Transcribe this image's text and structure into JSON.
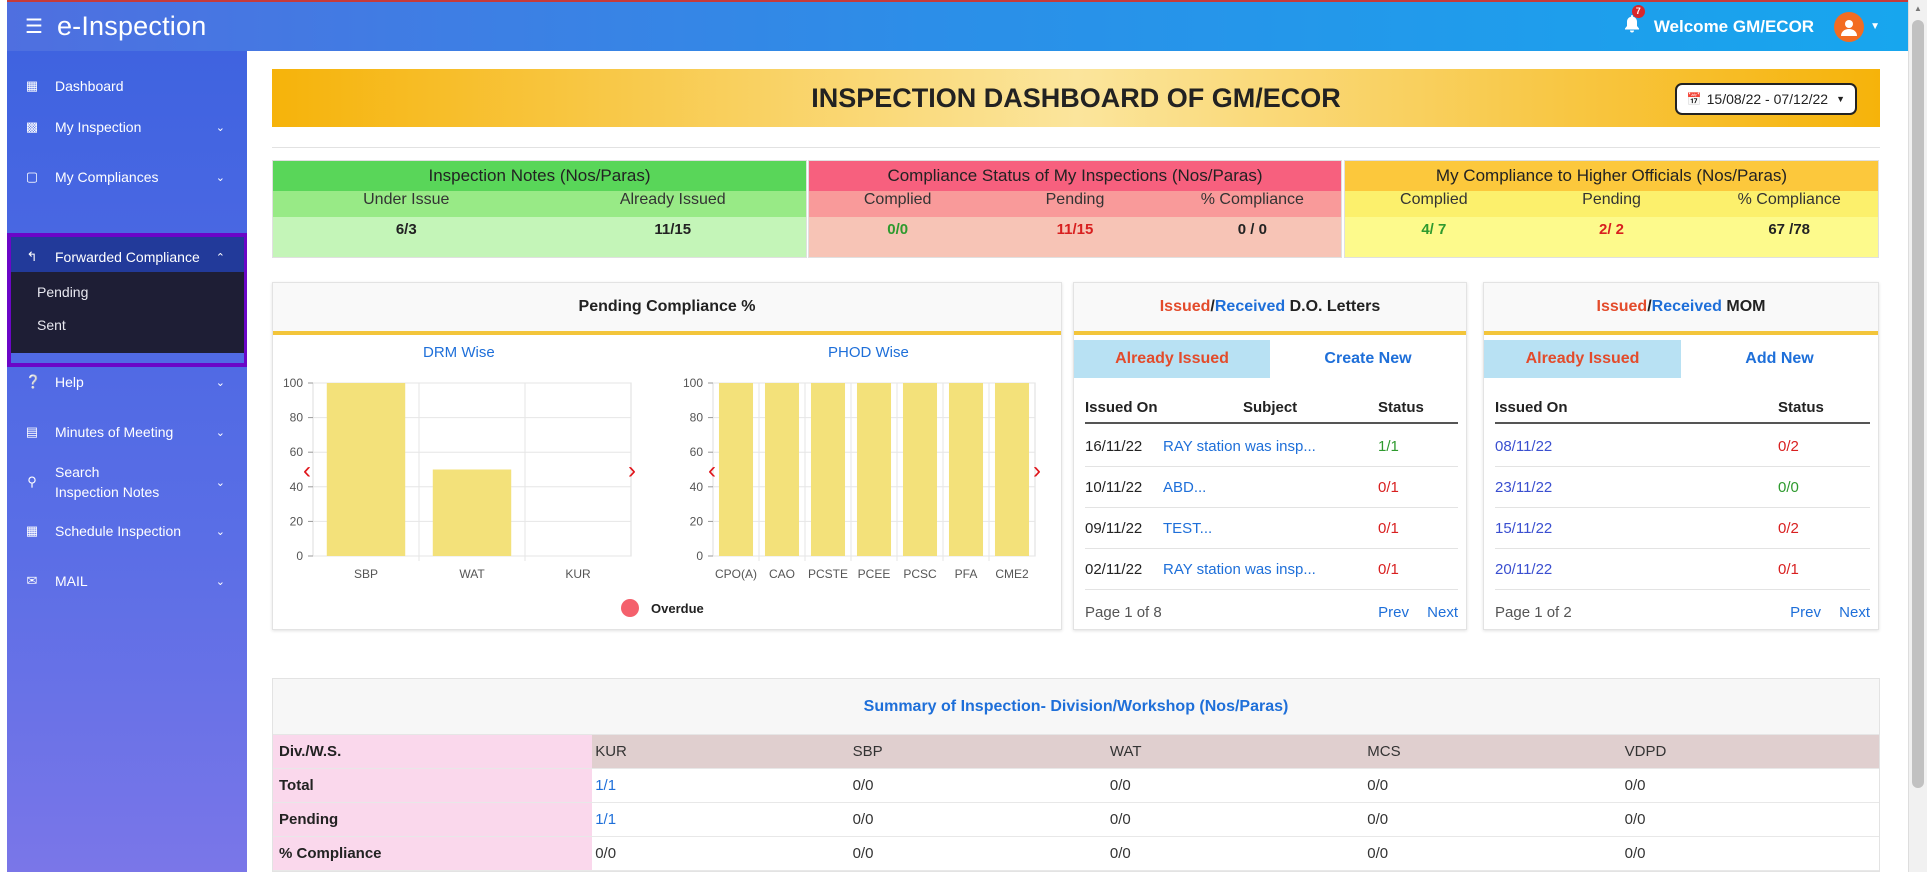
{
  "app": {
    "title": "e-Inspection",
    "notification_count": "7",
    "welcome": "Welcome  GM/ECOR"
  },
  "sidebar": {
    "items": [
      {
        "label": "Dashboard",
        "icon": "dashboard-icon"
      },
      {
        "label": "My Inspection",
        "icon": "clipboard-icon"
      },
      {
        "label": "My Compliances",
        "icon": "document-icon"
      },
      {
        "label": "Forwarded Compliance",
        "icon": "reply-icon"
      },
      {
        "label": "Help",
        "icon": "question-icon"
      },
      {
        "label": "Minutes of Meeting",
        "icon": "note-icon"
      },
      {
        "label": "Search Inspection Notes",
        "icon": "search-icon"
      },
      {
        "label": "Schedule Inspection",
        "icon": "calendar-icon"
      },
      {
        "label": "MAIL",
        "icon": "mail-icon"
      }
    ],
    "submenu": [
      "Pending",
      "Sent"
    ]
  },
  "header": {
    "title": "INSPECTION DASHBOARD OF GM/ECOR",
    "date_range": "15/08/22 - 07/12/22"
  },
  "stats": {
    "inspection_notes": {
      "title": "Inspection Notes (Nos/Paras)",
      "cols": [
        "Under Issue",
        "Already Issued"
      ],
      "values": [
        "6/3",
        "11/15"
      ]
    },
    "compliance_status": {
      "title": "Compliance Status of My Inspections (Nos/Paras)",
      "cols": [
        "Complied",
        "Pending",
        "% Compliance"
      ],
      "values": [
        "0/0",
        "11/15",
        "0 / 0"
      ]
    },
    "my_compliance": {
      "title": "My Compliance to Higher Officials (Nos/Paras)",
      "cols": [
        "Complied",
        "Pending",
        "% Compliance"
      ],
      "values": [
        "4/ 7",
        "2/ 2",
        "67 /78"
      ]
    }
  },
  "pending_card": {
    "title": "Pending Compliance %",
    "legend": "Overdue",
    "colors": {
      "bar": "#f3e17a",
      "legend_dot": "#f4606c"
    }
  },
  "chart_data": [
    {
      "type": "bar",
      "title": "DRM Wise",
      "categories": [
        "SBP",
        "WAT",
        "KUR"
      ],
      "values": [
        100,
        50,
        0
      ],
      "ylim": [
        0,
        100
      ],
      "yticks": [
        0,
        20,
        40,
        60,
        80,
        100
      ],
      "grid": true
    },
    {
      "type": "bar",
      "title": "PHOD Wise",
      "categories": [
        "CPO(A)",
        "CAO",
        "PCSTE",
        "PCEE",
        "PCSC",
        "PFA",
        "CME2"
      ],
      "values": [
        100,
        100,
        100,
        100,
        100,
        100,
        100
      ],
      "ylim": [
        0,
        100
      ],
      "yticks": [
        0,
        20,
        40,
        60,
        80,
        100
      ],
      "grid": true
    }
  ],
  "do_letters": {
    "title_issued": "Issued",
    "title_sep": "/",
    "title_received": "Received",
    "title_rest": " D.O. Letters",
    "tab_active": "Already Issued",
    "tab_other": "Create New",
    "headers": [
      "Issued On",
      "Subject",
      "Status"
    ],
    "rows": [
      {
        "date": "16/11/22",
        "subject": "RAY station was insp...",
        "status": "1/1",
        "status_color": "green"
      },
      {
        "date": "10/11/22",
        "subject": "ABD...",
        "status": "0/1",
        "status_color": "red"
      },
      {
        "date": "09/11/22",
        "subject": "TEST...",
        "status": "0/1",
        "status_color": "red"
      },
      {
        "date": "02/11/22",
        "subject": "RAY station was insp...",
        "status": "0/1",
        "status_color": "red"
      }
    ],
    "page": "Page 1 of 8",
    "prev": "Prev",
    "next": "Next"
  },
  "mom": {
    "title_issued": "Issued",
    "title_sep": "/",
    "title_received": "Received",
    "title_rest": " MOM",
    "tab_active": "Already Issued",
    "tab_other": "Add New",
    "headers": [
      "Issued On",
      "Status"
    ],
    "rows": [
      {
        "date": "08/11/22",
        "status": "0/2",
        "status_color": "red"
      },
      {
        "date": "23/11/22",
        "status": "0/0",
        "status_color": "green"
      },
      {
        "date": "15/11/22",
        "status": "0/2",
        "status_color": "red"
      },
      {
        "date": "20/11/22",
        "status": "0/1",
        "status_color": "red"
      }
    ],
    "page": "Page 1 of 2",
    "prev": "Prev",
    "next": "Next"
  },
  "summary": {
    "title": "Summary of Inspection- Division/Workshop (Nos/Paras)",
    "header_label": "Div./W.S.",
    "columns": [
      "KUR",
      "SBP",
      "WAT",
      "MCS",
      "VDPD"
    ],
    "rows": [
      {
        "label": "Total",
        "values": [
          "1/1",
          "0/0",
          "0/0",
          "0/0",
          "0/0"
        ]
      },
      {
        "label": "Pending",
        "values": [
          "1/1",
          "0/0",
          "0/0",
          "0/0",
          "0/0"
        ]
      },
      {
        "label": "% Compliance",
        "values": [
          "0/0",
          "0/0",
          "0/0",
          "0/0",
          "0/0"
        ]
      }
    ]
  }
}
